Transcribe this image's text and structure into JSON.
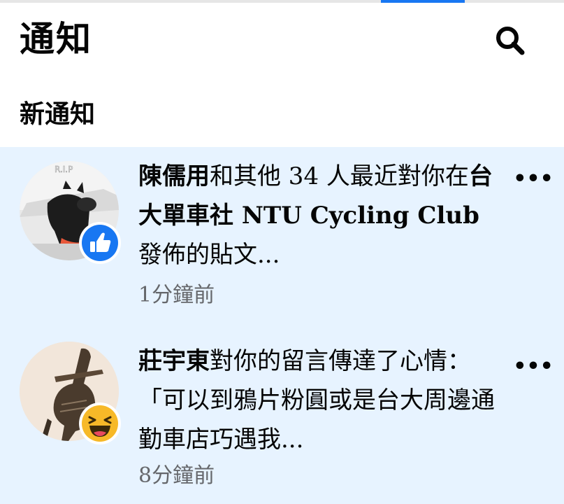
{
  "header": {
    "title": "通知",
    "search_icon": "search-icon"
  },
  "section": {
    "title": "新通知"
  },
  "colors": {
    "accent": "#1877f2",
    "unread_background": "#e7f3ff",
    "timestamp": "#65676b",
    "like_reaction": "#1877f2",
    "haha_reaction": "#f7b928"
  },
  "notifications": [
    {
      "actor": "陳儒用",
      "text_after_actor": "和其他 34 人最近對你在",
      "group": "台大單車社 NTU Cycling Club",
      "text_tail": " 發佈的貼文...",
      "time": "1分鐘前",
      "avatar_badge": "R.I.P",
      "reaction": "like-reaction-icon",
      "more": "•••"
    },
    {
      "actor": "莊宇東",
      "text_after_actor": "對你的留言傳達了心情：「可以到鴉片粉圓或是台大周邊通勤車店巧遇我...",
      "time": "8分鐘前",
      "reaction": "haha-reaction-icon",
      "more": "•••"
    }
  ]
}
